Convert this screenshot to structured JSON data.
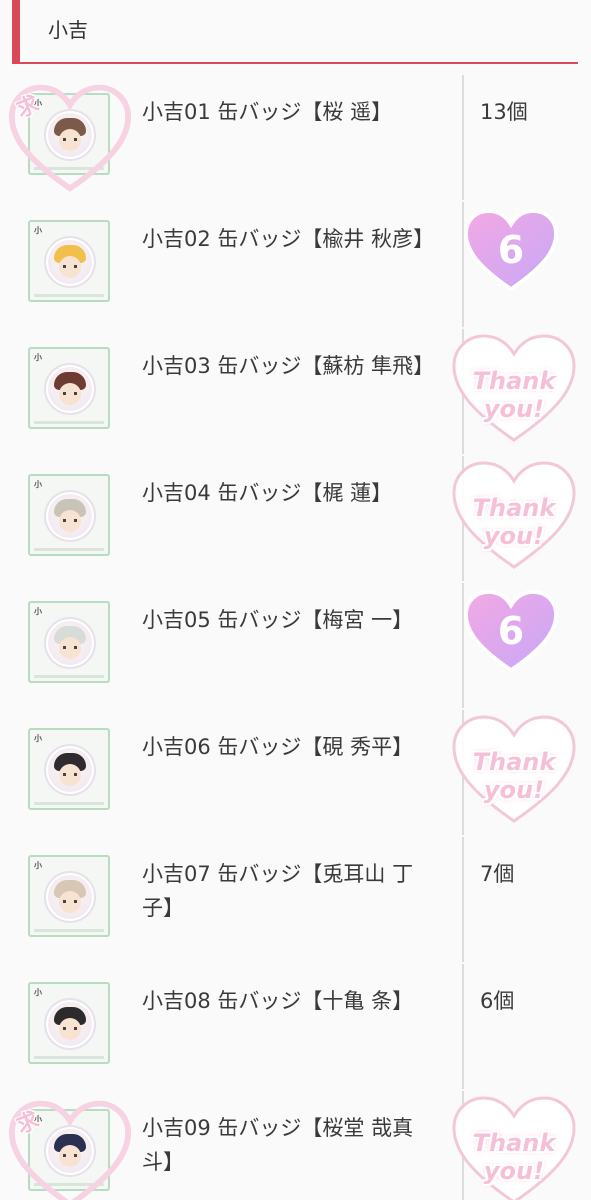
{
  "section": {
    "title": "小吉"
  },
  "colors": {
    "accent": "#d9495a",
    "sticker_pink": "#f6bfd8",
    "heart_gradient": [
      "#f3a9e4",
      "#c7a7f7"
    ]
  },
  "items": [
    {
      "name": "小吉01 缶バッジ【桜 遥】",
      "qty": "13個",
      "status": "",
      "thumb_sticker": "求",
      "hair": "#7b5a4a"
    },
    {
      "name": "小吉02 缶バッジ【楡井 秋彦】",
      "qty": "",
      "status": "6",
      "thumb_sticker": "",
      "hair": "#f0c04a"
    },
    {
      "name": "小吉03 缶バッジ【蘇枋 隼飛】",
      "qty": "",
      "status": "Thank you!",
      "thumb_sticker": "",
      "hair": "#6e3b32"
    },
    {
      "name": "小吉04 缶バッジ【梶 蓮】",
      "qty": "",
      "status": "Thank you!",
      "thumb_sticker": "",
      "hair": "#c9c4b8"
    },
    {
      "name": "小吉05 缶バッジ【梅宮 一】",
      "qty": "",
      "status": "6",
      "thumb_sticker": "",
      "hair": "#d8dcd8"
    },
    {
      "name": "小吉06 缶バッジ【硯 秀平】",
      "qty": "",
      "status": "Thank you!",
      "thumb_sticker": "",
      "hair": "#2e2a2e"
    },
    {
      "name": "小吉07 缶バッジ【兎耳山 丁子】",
      "qty": "7個",
      "status": "",
      "thumb_sticker": "",
      "hair": "#d9c7b5"
    },
    {
      "name": "小吉08 缶バッジ【十亀 条】",
      "qty": "6個",
      "status": "",
      "thumb_sticker": "",
      "hair": "#2c2a2a"
    },
    {
      "name": "小吉09 缶バッジ【桜堂 哉真斗】",
      "qty": "",
      "status": "Thank you!",
      "thumb_sticker": "求",
      "hair": "#2b3050"
    }
  ]
}
